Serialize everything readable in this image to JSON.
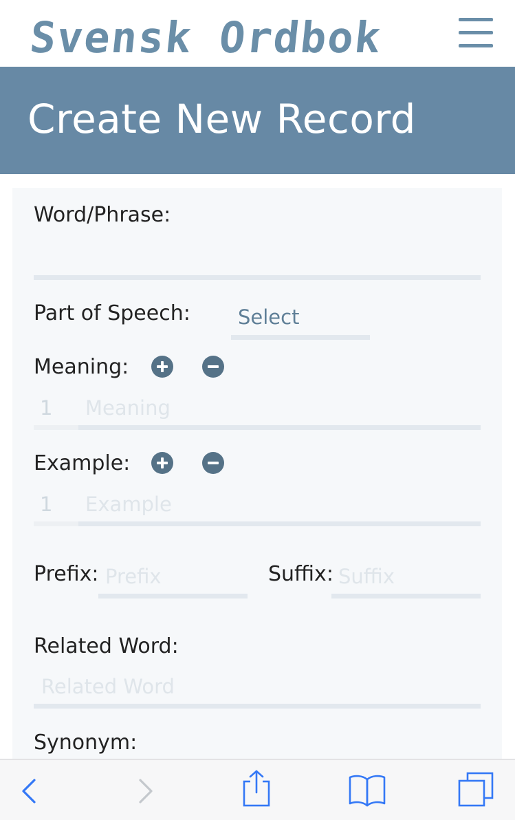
{
  "header": {
    "logo_text": "Svensk Ordbok",
    "menu_icon": "hamburger-menu-icon"
  },
  "banner": {
    "title": "Create New Record"
  },
  "form": {
    "word_label": "Word/Phrase:",
    "pos_label": "Part of Speech:",
    "pos_select_value": "Select",
    "meaning_label": "Meaning:",
    "meaning_number": "1",
    "meaning_placeholder": "Meaning",
    "example_label": "Example:",
    "example_number": "1",
    "example_placeholder": "Example",
    "prefix_label": "Prefix:",
    "prefix_placeholder": "Prefix",
    "suffix_label": "Suffix:",
    "suffix_placeholder": "Suffix",
    "related_label": "Related Word:",
    "related_placeholder": "Related Word",
    "synonym_label": "Synonym:"
  },
  "toolbar": {
    "icons": [
      "back-icon",
      "forward-icon",
      "share-icon",
      "bookmarks-icon",
      "tabs-icon"
    ]
  },
  "colors": {
    "accent": "#6789a5",
    "logo": "#6a8ea8",
    "button": "#557287",
    "ios_blue": "#3478f6"
  }
}
